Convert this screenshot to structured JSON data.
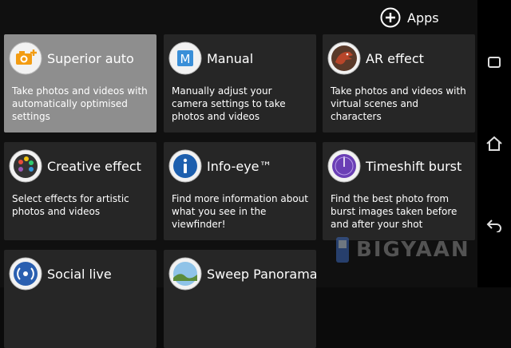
{
  "header": {
    "apps_label": "Apps"
  },
  "modes": [
    {
      "title": "Superior auto",
      "desc": "Take photos and videos with automatically optimised settings",
      "icon": "camera-plus-icon",
      "selected": true
    },
    {
      "title": "Manual",
      "desc": "Manually adjust your camera settings to take photos and videos",
      "icon": "m-icon"
    },
    {
      "title": "AR effect",
      "desc": "Take photos and videos with virtual scenes and characters",
      "icon": "dinosaur-icon"
    },
    {
      "title": "Creative effect",
      "desc": "Select effects for artistic photos and videos",
      "icon": "palette-icon"
    },
    {
      "title": "Info-eye™",
      "desc": "Find more information about what you see in the viewfinder!",
      "icon": "info-icon"
    },
    {
      "title": "Timeshift burst",
      "desc": "Find the best photo from burst images taken before and after your shot",
      "icon": "timeshift-icon"
    },
    {
      "title": "Social live",
      "desc": "",
      "icon": "broadcast-icon"
    },
    {
      "title": "Sweep Panorama",
      "desc": "",
      "icon": "panorama-icon"
    }
  ],
  "watermark": {
    "text": "BIGYAAN"
  },
  "colors": {
    "selected_tile": "#8e8e8e",
    "tile": "#262626",
    "background": "#101010"
  }
}
